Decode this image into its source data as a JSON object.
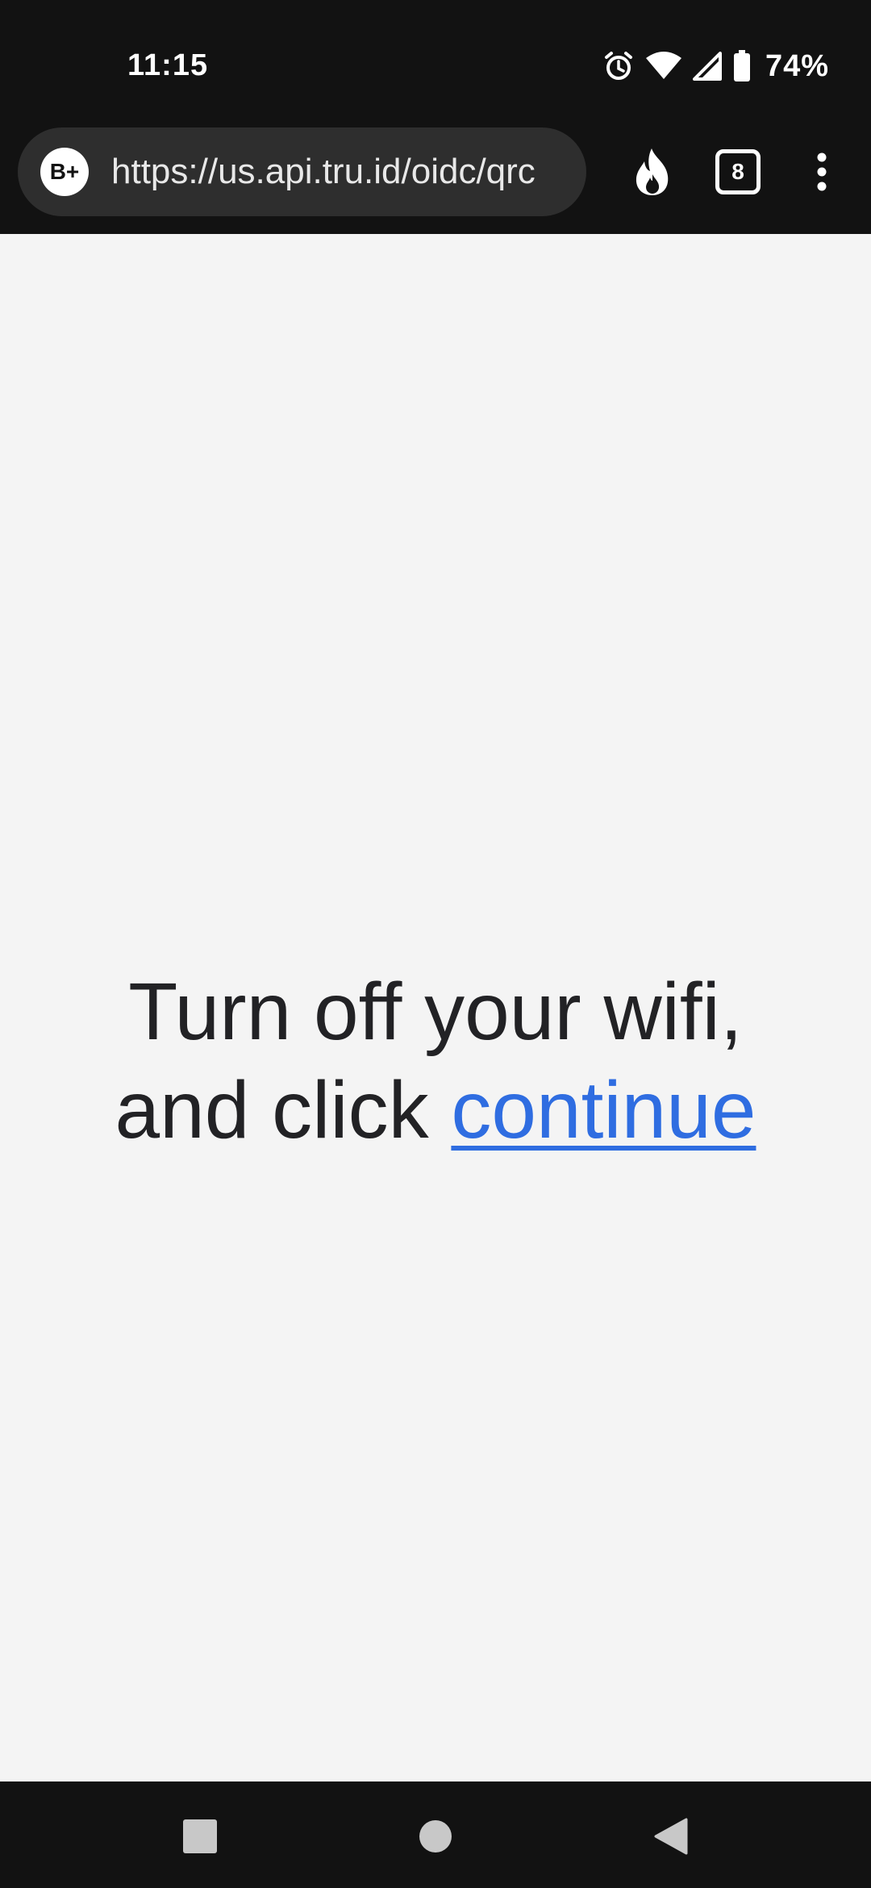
{
  "status_bar": {
    "time": "11:15",
    "battery_percent": "74%",
    "icons": [
      "alarm-icon",
      "wifi-icon",
      "signal-icon",
      "battery-icon"
    ]
  },
  "browser": {
    "site_badge": "B+",
    "url": "https://us.api.tru.id/oidc/qrc",
    "tab_count": "8",
    "icons": [
      "fire-icon",
      "tabs-icon",
      "more-menu-icon"
    ]
  },
  "page": {
    "line1": "Turn off your wifi,",
    "line2_prefix": "and click",
    "link_label": "continue",
    "link_color": "#2f6de1"
  },
  "nav_bar": {
    "icons": [
      "recents-icon",
      "home-icon",
      "back-icon"
    ]
  }
}
